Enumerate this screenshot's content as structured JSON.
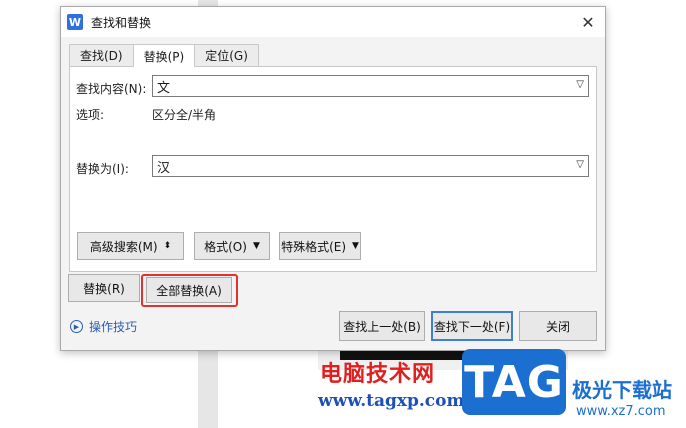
{
  "dialog": {
    "title": "查找和替换",
    "app_icon_letter": "W",
    "close_glyph": "✕"
  },
  "tabs": [
    {
      "label": "查找(D)",
      "active": false
    },
    {
      "label": "替换(P)",
      "active": true
    },
    {
      "label": "定位(G)",
      "active": false
    }
  ],
  "find": {
    "label": "查找内容(N):",
    "value": "文"
  },
  "options": {
    "label": "选项:",
    "value": "区分全/半角"
  },
  "replace": {
    "label": "替换为(I):",
    "value": "汉"
  },
  "panel_buttons": {
    "advanced_search": "高级搜索(M)",
    "format": "格式(O)",
    "special_format": "特殊格式(E)"
  },
  "actions": {
    "replace": "替换(R)",
    "replace_all": "全部替换(A)",
    "find_prev": "查找上一处(B)",
    "find_next": "查找下一处(F)",
    "close": "关闭"
  },
  "tips": {
    "label": "操作技巧"
  },
  "watermark": {
    "site_cn": "电脑技术网",
    "site_url": "www.tagxp.com",
    "logo": "TAG",
    "logo_cn": "极光下载站",
    "logo_url": "www.xz7.com"
  },
  "colors": {
    "highlight": "#e23131",
    "accent": "#3c7fd6",
    "link": "#2a5db0"
  }
}
